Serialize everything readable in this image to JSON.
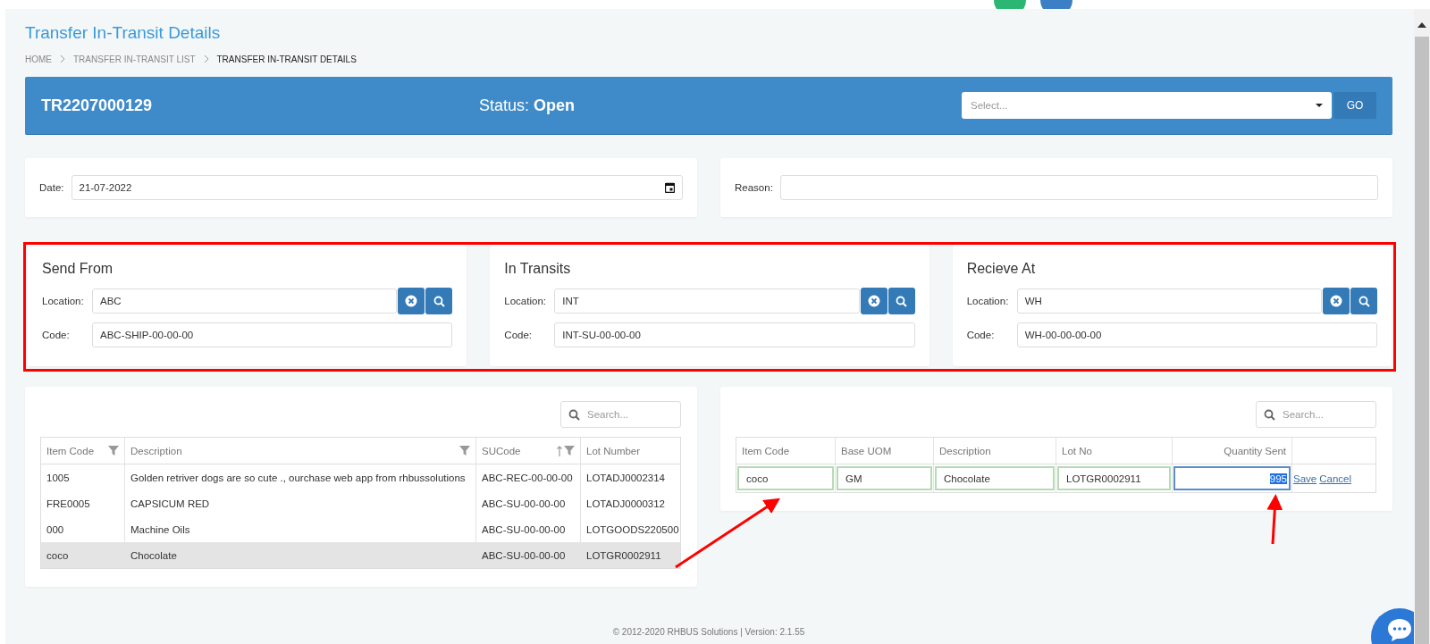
{
  "page_title": "Transfer In-Transit Details",
  "breadcrumb": [
    {
      "label": "HOME",
      "current": false
    },
    {
      "label": "TRANSFER IN-TRANSIT LIST",
      "current": false
    },
    {
      "label": "TRANSFER IN-TRANSIT DETAILS",
      "current": true
    }
  ],
  "header": {
    "number": "TR2207000129",
    "status_label": "Status:",
    "status_value": "Open",
    "select_placeholder": "Select...",
    "go_button": "GO"
  },
  "date": {
    "label": "Date:",
    "value": "21-07-2022"
  },
  "reason": {
    "label": "Reason:"
  },
  "locations": [
    {
      "title": "Send From",
      "location_label": "Location:",
      "location": "ABC",
      "code_label": "Code:",
      "code": "ABC-SHIP-00-00-00"
    },
    {
      "title": "In Transits",
      "location_label": "Location:",
      "location": "INT",
      "code_label": "Code:",
      "code": "INT-SU-00-00-00"
    },
    {
      "title": "Recieve At",
      "location_label": "Location:",
      "location": "WH",
      "code_label": "Code:",
      "code": "WH-00-00-00-00"
    }
  ],
  "items_table": {
    "search_placeholder": "Search...",
    "columns": [
      {
        "label": "Item Code",
        "filter": true,
        "sort": false
      },
      {
        "label": "Description",
        "filter": true,
        "sort": false
      },
      {
        "label": "SUCode",
        "filter": true,
        "sort": true
      },
      {
        "label": "Lot Number",
        "filter": false,
        "sort": false
      }
    ],
    "rows": [
      {
        "cells": [
          "1005",
          "Golden retriver dogs are so cute ., ourchase web app from rhbussolutions",
          "ABC-REC-00-00-00",
          "LOTADJ0002314"
        ],
        "selected": false
      },
      {
        "cells": [
          "FRE0005",
          " CAPSICUM RED",
          "ABC-SU-00-00-00",
          "LOTADJ0000312"
        ],
        "selected": false
      },
      {
        "cells": [
          "000",
          "Machine Oils",
          "ABC-SU-00-00-00",
          "LOTGOODS220500"
        ],
        "selected": false
      },
      {
        "cells": [
          "coco",
          "Chocolate",
          "ABC-SU-00-00-00",
          "LOTGR0002911"
        ],
        "selected": true
      }
    ]
  },
  "sent_table": {
    "search_placeholder": "Search...",
    "columns": [
      "Item Code",
      "Base UOM",
      "Description",
      "Lot No",
      "Quantity Sent"
    ],
    "edit_row": {
      "cells": [
        "coco",
        "GM",
        "Chocolate",
        "LOTGR0002911"
      ],
      "quantity": "995",
      "save": "Save",
      "cancel": "Cancel"
    }
  },
  "footer": "© 2012-2020 RHBUS Solutions | Version: 2.1.55"
}
